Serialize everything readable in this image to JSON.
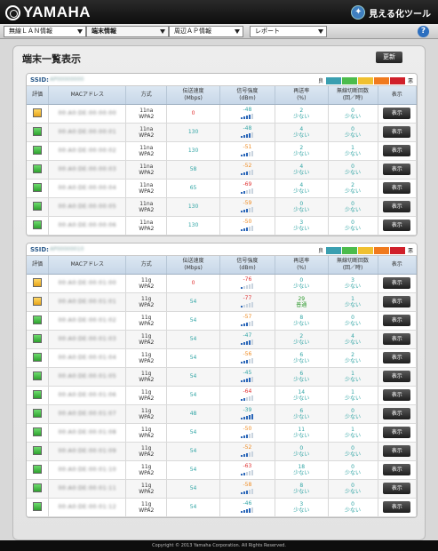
{
  "header": {
    "logo": "YAMAHA",
    "brand": "見える化ツール",
    "brand_icon": "graph-icon"
  },
  "menu": [
    {
      "label": "無線ＬＡＮ情報"
    },
    {
      "label": "端末情報"
    },
    {
      "label": "周辺ＡＰ情報"
    },
    {
      "label": "レポート"
    }
  ],
  "help_label": "?",
  "page": {
    "title": "端末一覧表示",
    "refresh_label": "更新"
  },
  "legend": {
    "good": "良",
    "bad": "悪",
    "colors": [
      "#3a9fb0",
      "#4cbc4c",
      "#f0c030",
      "#f07a1e",
      "#d0202a"
    ]
  },
  "columns": {
    "eval": "評価",
    "mac": "MACアドレス",
    "method": "方式",
    "speed": "伝送速度\n(Mbps)",
    "signal": "信号強度\n(dBm)",
    "resend": "再送率\n(%)",
    "disconnect": "無線切断回数\n(回／時)",
    "show": "表示"
  },
  "show_label": "表示",
  "ssid_label": "SSID:",
  "panels": [
    {
      "ssid": "AP00000000",
      "rows": [
        {
          "eval": "yellow",
          "mac": "00:A0:DE:00:00:00",
          "method": [
            "11na",
            "WPA2"
          ],
          "speed": "0",
          "speed_color": "red",
          "signal": "-48",
          "signal_color": "teal",
          "bars": 4,
          "resend": [
            "2",
            "少ない"
          ],
          "resend_color": "teal",
          "disc": [
            "0",
            "少ない"
          ],
          "disc_color": "teal"
        },
        {
          "eval": "green",
          "mac": "00:A0:DE:00:00:01",
          "method": [
            "11na",
            "WPA2"
          ],
          "speed": "130",
          "speed_color": "teal",
          "signal": "-48",
          "signal_color": "teal",
          "bars": 4,
          "resend": [
            "4",
            "少ない"
          ],
          "resend_color": "teal",
          "disc": [
            "0",
            "少ない"
          ],
          "disc_color": "teal"
        },
        {
          "eval": "green",
          "mac": "00:A0:DE:00:00:02",
          "method": [
            "11na",
            "WPA2"
          ],
          "speed": "130",
          "speed_color": "teal",
          "signal": "-51",
          "signal_color": "orange",
          "bars": 3,
          "resend": [
            "2",
            "少ない"
          ],
          "resend_color": "teal",
          "disc": [
            "1",
            "少ない"
          ],
          "disc_color": "teal"
        },
        {
          "eval": "green",
          "mac": "00:A0:DE:00:00:03",
          "method": [
            "11na",
            "WPA2"
          ],
          "speed": "58",
          "speed_color": "teal",
          "signal": "-52",
          "signal_color": "orange",
          "bars": 3,
          "resend": [
            "4",
            "少ない"
          ],
          "resend_color": "teal",
          "disc": [
            "0",
            "少ない"
          ],
          "disc_color": "teal"
        },
        {
          "eval": "green",
          "mac": "00:A0:DE:00:00:04",
          "method": [
            "11na",
            "WPA2"
          ],
          "speed": "65",
          "speed_color": "teal",
          "signal": "-69",
          "signal_color": "red",
          "bars": 2,
          "resend": [
            "4",
            "少ない"
          ],
          "resend_color": "teal",
          "disc": [
            "2",
            "少ない"
          ],
          "disc_color": "teal"
        },
        {
          "eval": "green",
          "mac": "00:A0:DE:00:00:05",
          "method": [
            "11na",
            "WPA2"
          ],
          "speed": "130",
          "speed_color": "teal",
          "signal": "-59",
          "signal_color": "orange",
          "bars": 3,
          "resend": [
            "0",
            "少ない"
          ],
          "resend_color": "teal",
          "disc": [
            "0",
            "少ない"
          ],
          "disc_color": "teal"
        },
        {
          "eval": "green",
          "mac": "00:A0:DE:00:00:06",
          "method": [
            "11na",
            "WPA2"
          ],
          "speed": "130",
          "speed_color": "teal",
          "signal": "-50",
          "signal_color": "orange",
          "bars": 3,
          "resend": [
            "3",
            "少ない"
          ],
          "resend_color": "teal",
          "disc": [
            "0",
            "少ない"
          ],
          "disc_color": "teal"
        }
      ]
    },
    {
      "ssid": "AP00000010",
      "rows": [
        {
          "eval": "yellow",
          "mac": "00:A0:DE:00:01:00",
          "method": [
            "11g",
            "WPA2"
          ],
          "speed": "0",
          "speed_color": "red",
          "signal": "-76",
          "signal_color": "red",
          "bars": 1,
          "resend": [
            "0",
            "少ない"
          ],
          "resend_color": "teal",
          "disc": [
            "3",
            "少ない"
          ],
          "disc_color": "teal"
        },
        {
          "eval": "yellow",
          "mac": "00:A0:DE:00:01:01",
          "method": [
            "11g",
            "WPA2"
          ],
          "speed": "54",
          "speed_color": "teal",
          "signal": "-77",
          "signal_color": "red",
          "bars": 1,
          "resend": [
            "29",
            "普通"
          ],
          "resend_color": "green",
          "disc": [
            "1",
            "少ない"
          ],
          "disc_color": "teal"
        },
        {
          "eval": "green",
          "mac": "00:A0:DE:00:01:02",
          "method": [
            "11g",
            "WPA2"
          ],
          "speed": "54",
          "speed_color": "teal",
          "signal": "-57",
          "signal_color": "orange",
          "bars": 3,
          "resend": [
            "8",
            "少ない"
          ],
          "resend_color": "teal",
          "disc": [
            "0",
            "少ない"
          ],
          "disc_color": "teal"
        },
        {
          "eval": "green",
          "mac": "00:A0:DE:00:01:03",
          "method": [
            "11g",
            "WPA2"
          ],
          "speed": "54",
          "speed_color": "teal",
          "signal": "-47",
          "signal_color": "teal",
          "bars": 4,
          "resend": [
            "2",
            "少ない"
          ],
          "resend_color": "teal",
          "disc": [
            "4",
            "少ない"
          ],
          "disc_color": "teal"
        },
        {
          "eval": "green",
          "mac": "00:A0:DE:00:01:04",
          "method": [
            "11g",
            "WPA2"
          ],
          "speed": "54",
          "speed_color": "teal",
          "signal": "-56",
          "signal_color": "orange",
          "bars": 3,
          "resend": [
            "6",
            "少ない"
          ],
          "resend_color": "teal",
          "disc": [
            "2",
            "少ない"
          ],
          "disc_color": "teal"
        },
        {
          "eval": "green",
          "mac": "00:A0:DE:00:01:05",
          "method": [
            "11g",
            "WPA2"
          ],
          "speed": "54",
          "speed_color": "teal",
          "signal": "-45",
          "signal_color": "teal",
          "bars": 4,
          "resend": [
            "6",
            "少ない"
          ],
          "resend_color": "teal",
          "disc": [
            "1",
            "少ない"
          ],
          "disc_color": "teal"
        },
        {
          "eval": "green",
          "mac": "00:A0:DE:00:01:06",
          "method": [
            "11g",
            "WPA2"
          ],
          "speed": "54",
          "speed_color": "teal",
          "signal": "-64",
          "signal_color": "red",
          "bars": 2,
          "resend": [
            "14",
            "少ない"
          ],
          "resend_color": "teal",
          "disc": [
            "1",
            "少ない"
          ],
          "disc_color": "teal"
        },
        {
          "eval": "green",
          "mac": "00:A0:DE:00:01:07",
          "method": [
            "11g",
            "WPA2"
          ],
          "speed": "48",
          "speed_color": "teal",
          "signal": "-39",
          "signal_color": "teal",
          "bars": 5,
          "resend": [
            "6",
            "少ない"
          ],
          "resend_color": "teal",
          "disc": [
            "0",
            "少ない"
          ],
          "disc_color": "teal"
        },
        {
          "eval": "green",
          "mac": "00:A0:DE:00:01:08",
          "method": [
            "11g",
            "WPA2"
          ],
          "speed": "54",
          "speed_color": "teal",
          "signal": "-50",
          "signal_color": "orange",
          "bars": 3,
          "resend": [
            "11",
            "少ない"
          ],
          "resend_color": "teal",
          "disc": [
            "1",
            "少ない"
          ],
          "disc_color": "teal"
        },
        {
          "eval": "green",
          "mac": "00:A0:DE:00:01:09",
          "method": [
            "11g",
            "WPA2"
          ],
          "speed": "54",
          "speed_color": "teal",
          "signal": "-52",
          "signal_color": "orange",
          "bars": 3,
          "resend": [
            "0",
            "少ない"
          ],
          "resend_color": "teal",
          "disc": [
            "0",
            "少ない"
          ],
          "disc_color": "teal"
        },
        {
          "eval": "green",
          "mac": "00:A0:DE:00:01:10",
          "method": [
            "11g",
            "WPA2"
          ],
          "speed": "54",
          "speed_color": "teal",
          "signal": "-63",
          "signal_color": "red",
          "bars": 2,
          "resend": [
            "18",
            "少ない"
          ],
          "resend_color": "teal",
          "disc": [
            "0",
            "少ない"
          ],
          "disc_color": "teal"
        },
        {
          "eval": "green",
          "mac": "00:A0:DE:00:01:11",
          "method": [
            "11g",
            "WPA2"
          ],
          "speed": "54",
          "speed_color": "teal",
          "signal": "-58",
          "signal_color": "orange",
          "bars": 3,
          "resend": [
            "8",
            "少ない"
          ],
          "resend_color": "teal",
          "disc": [
            "0",
            "少ない"
          ],
          "disc_color": "teal"
        },
        {
          "eval": "green",
          "mac": "00:A0:DE:00:01:12",
          "method": [
            "11g",
            "WPA2"
          ],
          "speed": "54",
          "speed_color": "teal",
          "signal": "-46",
          "signal_color": "teal",
          "bars": 4,
          "resend": [
            "3",
            "少ない"
          ],
          "resend_color": "teal",
          "disc": [
            "0",
            "少ない"
          ],
          "disc_color": "teal"
        }
      ]
    }
  ],
  "footer": "Copyright © 2013 Yamaha Corporation. All Rights Reserved."
}
